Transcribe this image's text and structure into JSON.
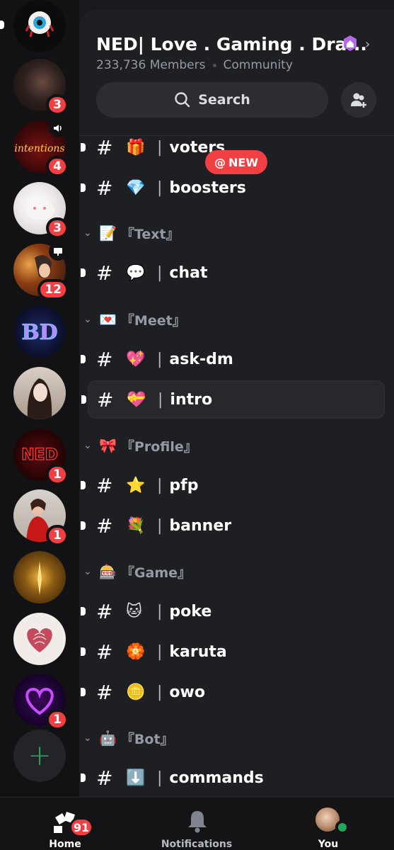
{
  "server": {
    "name": "NED| Love . Gaming . Dra...",
    "members": "233,736 Members",
    "type": "Community"
  },
  "search": {
    "label": "Search"
  },
  "new_badge": {
    "label": "NEW",
    "at": "@"
  },
  "rail": {
    "servers": [
      {
        "name": "eye-server",
        "badge": null
      },
      {
        "name": "dark-portrait-server",
        "badge": "3"
      },
      {
        "name": "intentions-server",
        "badge": "4",
        "extra_icon": "speaker-icon"
      },
      {
        "name": "bunny-server",
        "badge": "3"
      },
      {
        "name": "anime-server",
        "badge": "12",
        "extra_icon": "screen-share-icon"
      },
      {
        "name": "bd-server",
        "badge": null
      },
      {
        "name": "girl-portrait-server",
        "badge": null
      },
      {
        "name": "ned-server",
        "badge": "1"
      },
      {
        "name": "red-dress-server",
        "badge": "1"
      },
      {
        "name": "gold-art-server",
        "badge": null
      },
      {
        "name": "fingerprint-heart-server",
        "badge": null
      },
      {
        "name": "purple-heart-server",
        "badge": "1"
      }
    ]
  },
  "channels": [
    {
      "kind": "channel",
      "emoji": "🎁",
      "name": "voters"
    },
    {
      "kind": "channel",
      "emoji": "💎",
      "name": "boosters"
    },
    {
      "kind": "category",
      "emoji": "📝",
      "name": "『Text』"
    },
    {
      "kind": "channel",
      "emoji": "💬",
      "name": "chat"
    },
    {
      "kind": "category",
      "emoji": "💌",
      "name": "『Meet』"
    },
    {
      "kind": "channel",
      "emoji": "💖",
      "name": "ask-dm"
    },
    {
      "kind": "channel",
      "emoji": "💝",
      "name": "intro",
      "selected": true
    },
    {
      "kind": "category",
      "emoji": "🎀",
      "name": "『Profile』"
    },
    {
      "kind": "channel",
      "emoji": "⭐",
      "name": "pfp"
    },
    {
      "kind": "channel",
      "emoji": "💐",
      "name": "banner"
    },
    {
      "kind": "category",
      "emoji": "🎰",
      "name": "『Game』"
    },
    {
      "kind": "channel",
      "emoji": "🐱",
      "name": "poke"
    },
    {
      "kind": "channel",
      "emoji": "🏵️",
      "name": "karuta"
    },
    {
      "kind": "channel",
      "emoji": "🪙",
      "name": "owo"
    },
    {
      "kind": "category",
      "emoji": "🤖",
      "name": "『Bot』"
    },
    {
      "kind": "channel",
      "emoji": "⬇️",
      "name": "commands"
    }
  ],
  "symbols": {
    "hash": "#",
    "divider": "|"
  },
  "nav": {
    "home": "Home",
    "home_badge": "91",
    "notifications": "Notifications",
    "you": "You"
  },
  "colors": {
    "accent_red": "#f23f43",
    "online_green": "#23a55a"
  }
}
